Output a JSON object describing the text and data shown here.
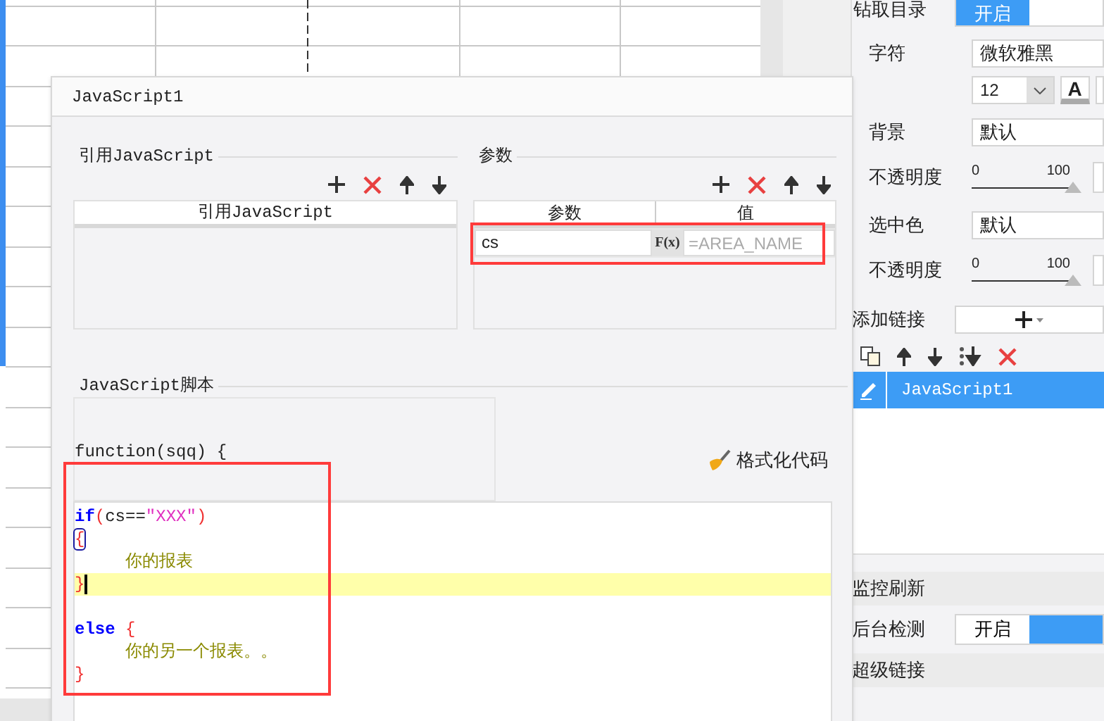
{
  "dialog": {
    "title": "JavaScript1",
    "reference": {
      "title": "引用JavaScript",
      "columns": [
        "引用JavaScript"
      ]
    },
    "params": {
      "title": "参数",
      "columns": [
        "参数",
        "值"
      ],
      "rows": [
        {
          "name": "cs",
          "formula": "F(x)",
          "placeholder": "=AREA_NAME"
        }
      ]
    },
    "script": {
      "title": "JavaScript脚本",
      "header": "function(sqq) {",
      "format_button": "格式化代码",
      "lines": [
        {
          "tokens": [
            {
              "kind": "keyword",
              "text": "if"
            },
            {
              "kind": "paren",
              "text": "("
            },
            {
              "kind": "plain",
              "text": "cs=="
            },
            {
              "kind": "string",
              "text": "\"XXX\""
            },
            {
              "kind": "paren",
              "text": ")"
            }
          ],
          "indented": false,
          "current": false
        },
        {
          "tokens": [
            {
              "kind": "matched-brace",
              "text": "{"
            }
          ],
          "indented": false,
          "current": false
        },
        {
          "tokens": [
            {
              "kind": "text",
              "text": "你的报表"
            }
          ],
          "indented": true,
          "current": false
        },
        {
          "tokens": [
            {
              "kind": "paren",
              "text": "}"
            }
          ],
          "indented": false,
          "current": true
        },
        {
          "current": false
        },
        {
          "tokens": [
            {
              "kind": "keyword",
              "text": "else"
            },
            {
              "kind": "paren",
              "text": "{",
              "gap": true
            }
          ],
          "indented": false,
          "current": false
        },
        {
          "tokens": [
            {
              "kind": "text",
              "text": "你的另一个报表。。"
            }
          ],
          "indented": true,
          "current": false
        },
        {
          "tokens": [
            {
              "kind": "paren",
              "text": "}"
            }
          ],
          "indented": false,
          "current": false
        }
      ]
    }
  },
  "panel": {
    "drill": {
      "label": "钻取目录",
      "options": [
        {
          "label": "开启",
          "selected": true
        },
        {
          "selected": false
        }
      ]
    },
    "font": {
      "label": "字符",
      "value": "微软雅黑",
      "size": "12",
      "color_button": "A"
    },
    "background": {
      "label": "背景",
      "value": "默认"
    },
    "opacity_1": {
      "label": "不透明度",
      "min": "0",
      "max": "100",
      "level": 1
    },
    "selected_color": {
      "label": "选中色",
      "value": "默认"
    },
    "opacity_2": {
      "label": "不透明度",
      "min": "0",
      "max": "100",
      "level": 1
    },
    "add_link": {
      "label": "添加链接"
    },
    "links": [
      {
        "label": "JavaScript1",
        "selected": true
      }
    ],
    "monitor": {
      "title": "监控刷新",
      "label": "后台检测",
      "options": [
        {
          "label": "开启",
          "selected": false
        },
        {
          "selected": true
        }
      ]
    },
    "hyperlink": {
      "title": "超级链接"
    }
  }
}
